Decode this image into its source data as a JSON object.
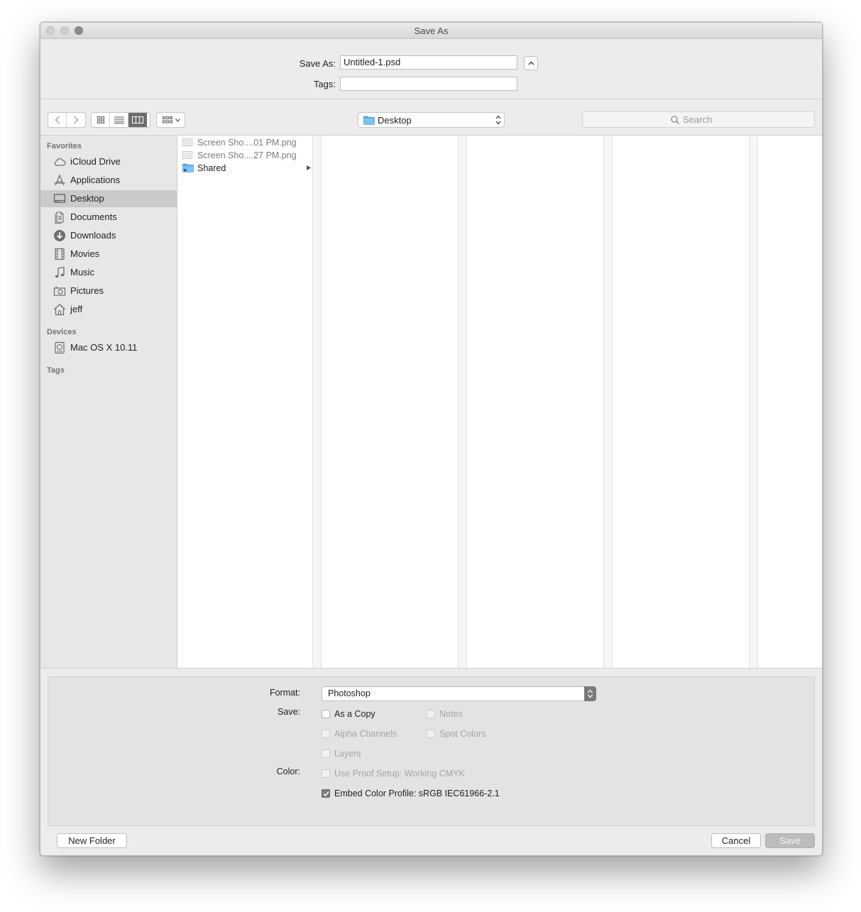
{
  "window": {
    "title": "Save As"
  },
  "header": {
    "save_as_label": "Save As:",
    "filename": "Untitled-1.psd",
    "tags_label": "Tags:",
    "tags_value": ""
  },
  "toolbar": {
    "back_icon": "chevron-left-icon",
    "forward_icon": "chevron-right-icon",
    "views": [
      "icon-view",
      "list-view",
      "column-view"
    ],
    "active_view": "column-view",
    "arrange": "group-arrange",
    "location": "Desktop",
    "search_placeholder": "Search"
  },
  "sidebar": {
    "favorites_label": "Favorites",
    "favorites": [
      {
        "label": "iCloud Drive",
        "icon": "cloud-icon"
      },
      {
        "label": "Applications",
        "icon": "applications-icon"
      },
      {
        "label": "Desktop",
        "icon": "desktop-icon",
        "selected": true
      },
      {
        "label": "Documents",
        "icon": "documents-icon"
      },
      {
        "label": "Downloads",
        "icon": "downloads-icon"
      },
      {
        "label": "Movies",
        "icon": "film-icon"
      },
      {
        "label": "Music",
        "icon": "music-note-icon"
      },
      {
        "label": "Pictures",
        "icon": "camera-icon"
      },
      {
        "label": "jeff",
        "icon": "home-icon"
      }
    ],
    "devices_label": "Devices",
    "devices": [
      {
        "label": "Mac OS X 10.11",
        "icon": "disk-icon"
      }
    ],
    "tags_label": "Tags"
  },
  "browser": {
    "files": [
      {
        "name": "Screen Sho....01 PM.png",
        "kind": "image",
        "enabled": false
      },
      {
        "name": "Screen Sho....27 PM.png",
        "kind": "image",
        "enabled": false
      },
      {
        "name": "Shared",
        "kind": "folder",
        "enabled": true,
        "has_children": true
      }
    ]
  },
  "options": {
    "format_label": "Format:",
    "format_value": "Photoshop",
    "save_label": "Save:",
    "color_label": "Color:",
    "as_a_copy": "As a Copy",
    "notes": "Notes",
    "alpha_channels": "Alpha Channels",
    "spot_colors": "Spot Colors",
    "layers": "Layers",
    "use_proof_setup": "Use Proof Setup:  Working CMYK",
    "embed_color_profile": "Embed Color Profile:  sRGB IEC61966-2.1"
  },
  "buttons": {
    "new_folder": "New Folder",
    "cancel": "Cancel",
    "save": "Save"
  }
}
